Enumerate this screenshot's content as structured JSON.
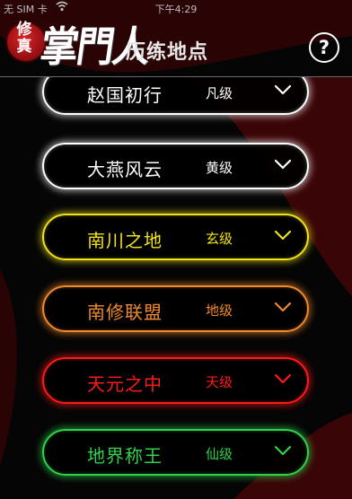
{
  "status_bar": {
    "carrier": "无 SIM 卡",
    "time": "下午4:29"
  },
  "header": {
    "logo_seal": "修真",
    "logo_title": "掌門人",
    "page_title": "历练地点",
    "help_label": "?"
  },
  "locations": [
    {
      "name": "赵国初行",
      "grade": "凡级",
      "color": "#ffffff"
    },
    {
      "name": "大燕风云",
      "grade": "黄级",
      "color": "#ffffff"
    },
    {
      "name": "南川之地",
      "grade": "玄级",
      "color": "#f2e21c"
    },
    {
      "name": "南修联盟",
      "grade": "地级",
      "color": "#f08a2c"
    },
    {
      "name": "天元之中",
      "grade": "天级",
      "color": "#ff1a1a"
    },
    {
      "name": "地界称王",
      "grade": "仙级",
      "color": "#2fd24a"
    }
  ],
  "colors": {
    "background": "#050505",
    "swoosh": "#3a0507"
  }
}
